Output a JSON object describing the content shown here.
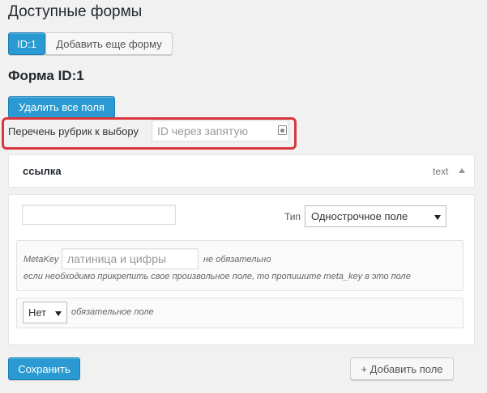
{
  "page": {
    "title": "Доступные формы",
    "form_heading": "Форма ID:1"
  },
  "tabs": {
    "active_label": "ID:1",
    "add_label": "Добавить еще форму"
  },
  "actions": {
    "delete_all_label": "Удалить все поля",
    "save_label": "Сохранить",
    "add_field_label": "+ Добавить поле"
  },
  "categories": {
    "label": "Перечень рубрик к выбору",
    "placeholder": "ID через запятую",
    "value": ""
  },
  "field": {
    "name": "ссылка",
    "type_tag": "text",
    "name_input_value": "",
    "type_label": "Тип",
    "type_selected": "Однострочное поле",
    "metakey": {
      "label": "MetaKey",
      "placeholder": "латиница и цифры",
      "value": "",
      "optional_note": "не обязательно",
      "help": "если необходимо прикрепить свое произвольное поле, то пропишите meta_key в это поле"
    },
    "required": {
      "selected": "Нет",
      "label": "обязательное поле"
    }
  },
  "colors": {
    "primary_button": "#2b9ad2",
    "highlight_border": "#d9363e"
  }
}
